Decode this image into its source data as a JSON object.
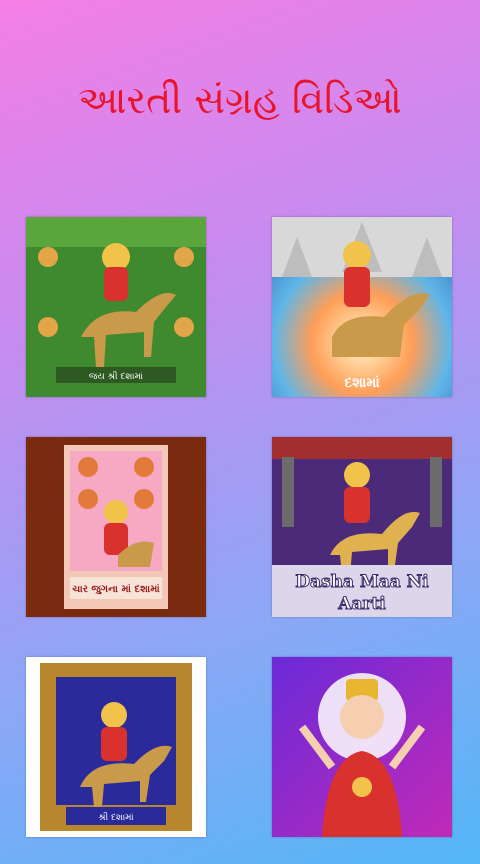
{
  "header": {
    "title": "આરતી સંગ્રહ વિડિઓ"
  },
  "videos": [
    {
      "caption": "જય શ્રી દશામાં"
    },
    {
      "caption": "દશામાં"
    },
    {
      "caption": "ચાર જુગના માં દશામાં"
    },
    {
      "caption_line1": "Dasha Maa Ni",
      "caption_line2": "Aarti"
    },
    {
      "caption": "શ્રી દશામાં"
    },
    {
      "caption": ""
    }
  ],
  "colors": {
    "title": "#e8142b",
    "bg_top": "#f47ee6",
    "bg_bottom": "#52b6f7"
  }
}
